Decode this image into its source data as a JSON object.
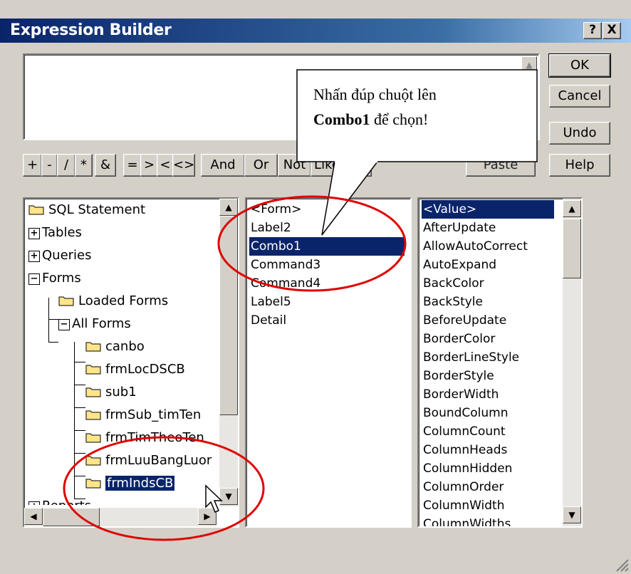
{
  "window": {
    "title": "Expression Builder",
    "help_glyph": "?",
    "close_glyph": "X"
  },
  "buttons": {
    "ok": "OK",
    "cancel": "Cancel",
    "undo": "Undo",
    "help": "Help",
    "paste": "Paste"
  },
  "operators": [
    "+",
    "-",
    "/",
    "*",
    "&",
    "=",
    ">",
    "<",
    "<>",
    "And",
    "Or",
    "Not",
    "Like",
    "()"
  ],
  "callout": {
    "line1": "Nhấn đúp chuột lên",
    "bold": "Combo1",
    "rest": " để chọn!"
  },
  "tree": {
    "items": [
      {
        "label": "SQL Statement",
        "box": ""
      },
      {
        "label": "Tables",
        "box": "+"
      },
      {
        "label": "Queries",
        "box": "+"
      },
      {
        "label": "Forms",
        "box": "−"
      },
      {
        "label": "Loaded Forms",
        "box": ""
      },
      {
        "label": "All Forms",
        "box": "−"
      },
      {
        "label": "canbo",
        "box": ""
      },
      {
        "label": "frmLocDSCB",
        "box": ""
      },
      {
        "label": "sub1",
        "box": ""
      },
      {
        "label": "frmSub_timTen",
        "box": ""
      },
      {
        "label": "frmTimTheoTen",
        "box": ""
      },
      {
        "label": "frmLuuBangLuor",
        "box": ""
      },
      {
        "label": "frmIndsCB",
        "box": "",
        "selected": true
      },
      {
        "label": "Reports",
        "box": "+"
      }
    ]
  },
  "middle_list": [
    "<Form>",
    "Label2",
    "Combo1",
    "Command3",
    "Command4",
    "Label5",
    "Detail"
  ],
  "middle_selected": "Combo1",
  "right_list": [
    "<Value>",
    "AfterUpdate",
    "AllowAutoCorrect",
    "AutoExpand",
    "BackColor",
    "BackStyle",
    "BeforeUpdate",
    "BorderColor",
    "BorderLineStyle",
    "BorderStyle",
    "BorderWidth",
    "BoundColumn",
    "ColumnCount",
    "ColumnHeads",
    "ColumnHidden",
    "ColumnOrder",
    "ColumnWidth",
    "ColumnWidths"
  ],
  "right_selected": "<Value>",
  "colors": {
    "titlebar": "#0a246a",
    "selection": "#0a246a",
    "highlight_ellipse": "#e00000",
    "dialog_face": "#d4d0c8"
  },
  "icons": {
    "folder": "folder-icon",
    "scroll_up": "scroll-up-icon",
    "scroll_down": "scroll-down-icon",
    "scroll_left": "scroll-left-icon",
    "scroll_right": "scroll-right-icon",
    "cursor": "arrow-cursor-icon",
    "resize_grip": "resize-grip-icon"
  }
}
